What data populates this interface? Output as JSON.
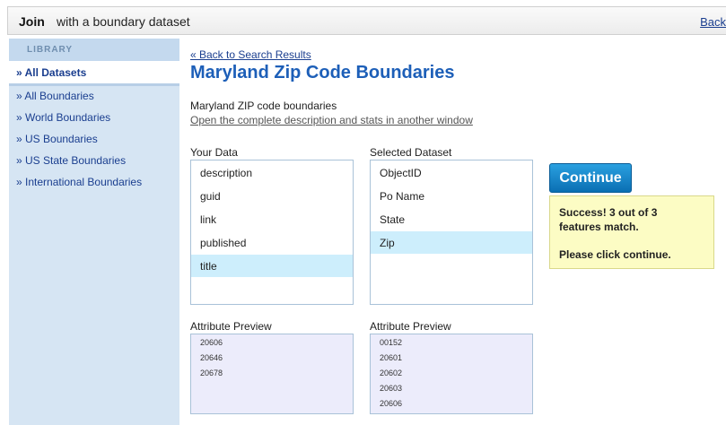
{
  "header": {
    "title_bold": "Join",
    "title_rest": "with a boundary dataset",
    "back_label": "Back"
  },
  "sidebar": {
    "heading": "LIBRARY",
    "selected": "» All Datasets",
    "items": [
      {
        "label": "» All Boundaries"
      },
      {
        "label": "» World Boundaries"
      },
      {
        "label": "» US Boundaries"
      },
      {
        "label": "» US State Boundaries"
      },
      {
        "label": "» International Boundaries"
      }
    ]
  },
  "main": {
    "back_link": "« Back to Search Results",
    "title": "Maryland Zip Code Boundaries",
    "description": "Maryland ZIP code boundaries",
    "open_link": "Open the complete description and stats in another window"
  },
  "your_data": {
    "label": "Your Data",
    "fields": [
      "description",
      "guid",
      "link",
      "published",
      "title"
    ],
    "selected": "title",
    "preview_label": "Attribute Preview",
    "preview": [
      "20606",
      "20646",
      "20678"
    ]
  },
  "selected_dataset": {
    "label": "Selected Dataset",
    "fields": [
      "ObjectID",
      "Po Name",
      "State",
      "Zip"
    ],
    "selected": "Zip",
    "preview_label": "Attribute Preview",
    "preview": [
      "00152",
      "20601",
      "20602",
      "20603",
      "20606"
    ]
  },
  "actions": {
    "continue_label": "Continue"
  },
  "message": {
    "line1": "Success! 3 out of 3 features match.",
    "line2": "Please click continue."
  },
  "colors": {
    "accent": "#1d5fb8",
    "highlight": "#cdeefc",
    "sidebar": "#d6e5f3",
    "message_bg": "#fcfcc4"
  }
}
